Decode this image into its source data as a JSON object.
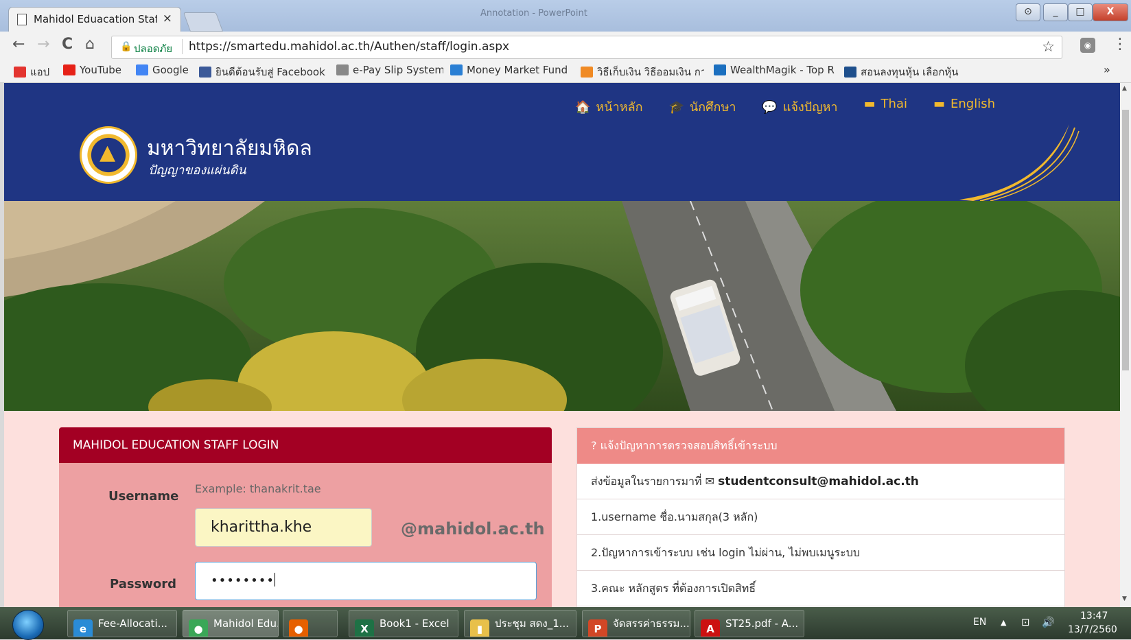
{
  "window": {
    "tab_title": "Mahidol Eduacation Staff",
    "tab_close": "×",
    "caption": "Annotation - PowerPoint",
    "controls": {
      "minimize": "_",
      "maximize": "□",
      "close": "X"
    }
  },
  "toolbar": {
    "back": "←",
    "forward": "→",
    "reload": "C",
    "home": "⌂",
    "secure_label": "ปลอดภัย",
    "url": "https://smartedu.mahidol.ac.th/Authen/staff/login.aspx",
    "star": "☆",
    "menu": "⋮"
  },
  "bookmarks": {
    "items": [
      {
        "label": "แอป",
        "icon": "apps-grid-icon",
        "color": "#e3342f"
      },
      {
        "label": "YouTube",
        "icon": "youtube-icon",
        "color": "#e62117"
      },
      {
        "label": "Google",
        "icon": "google-icon",
        "color": "#4285f4"
      },
      {
        "label": "ยินดีต้อนรับสู่ Facebook",
        "icon": "facebook-icon",
        "color": "#3b5998"
      },
      {
        "label": "e-Pay Slip System",
        "icon": "page-icon",
        "color": "#888888"
      },
      {
        "label": "Money Market Fund",
        "icon": "chart-icon",
        "color": "#2a7fd4"
      },
      {
        "label": "วิธีเก็บเงิน วิธีออมเงิน กา",
        "icon": "k-icon",
        "color": "#f08a24"
      },
      {
        "label": "WealthMagik - Top R",
        "icon": "wm-icon",
        "color": "#1b6fbf"
      },
      {
        "label": "สอนลงทุนหุ้น เลือกหุ้น แ",
        "icon": "a-icon",
        "color": "#1e4f8c"
      }
    ],
    "more": "»"
  },
  "site": {
    "university_name": "มหาวิทยาลัยมหิดล",
    "motto": "ปัญญาของแผ่นดิน",
    "nav": [
      {
        "label": "หน้าหลัก",
        "icon": "🏠"
      },
      {
        "label": "นักศึกษา",
        "icon": "🎓"
      },
      {
        "label": "แจ้งปัญหา",
        "icon": "💬"
      },
      {
        "label": "Thai",
        "icon": "▬"
      },
      {
        "label": "English",
        "icon": "▬"
      }
    ]
  },
  "login": {
    "heading": "MAHIDOL EDUCATION STAFF LOGIN",
    "username_label": "Username",
    "username_hint": "Example: thanakrit.tae",
    "username_value": "kharittha.khe",
    "domain_suffix": "@mahidol.ac.th",
    "password_label": "Password",
    "password_masked": "••••••••"
  },
  "help": {
    "heading": "? แจ้งปัญหาการตรวจสอบสิทธิ์เข้าระบบ",
    "intro": "ส่งข้อมูลในรายการมาที่ ✉",
    "email": "studentconsult@mahidol.ac.th",
    "items": [
      "1.username ชื่อ.นามสกุล(3 หลัก)",
      "2.ปัญหาการเข้าระบบ เช่น login ไม่ผ่าน, ไม่พบเมนูระบบ",
      "3.คณะ หลักสูตร ที่ต้องการเปิดสิทธิ์"
    ]
  },
  "taskbar": {
    "items": [
      {
        "label": "Fee-Allocati...",
        "icon": "ie-icon",
        "glyph": "e",
        "color": "#2a8bd6"
      },
      {
        "label": "Mahidol Edu...",
        "icon": "chrome-icon",
        "glyph": "●",
        "color": "#3aa757",
        "active": true
      },
      {
        "label": "",
        "icon": "firefox-icon",
        "glyph": "●",
        "color": "#e66000"
      },
      {
        "label": "Book1 - Excel",
        "icon": "excel-icon",
        "glyph": "X",
        "color": "#1e7145"
      },
      {
        "label": "ประชุม สดง_1...",
        "icon": "folder-icon",
        "glyph": "▮",
        "color": "#e8c04a"
      },
      {
        "label": "จัดสรรค่าธรรม...",
        "icon": "powerpoint-icon",
        "glyph": "P",
        "color": "#d24726"
      },
      {
        "label": "ST25.pdf - A...",
        "icon": "pdf-icon",
        "glyph": "A",
        "color": "#cc1111"
      }
    ],
    "tray": {
      "lang": "EN",
      "arrow": "▲",
      "network": "⊡",
      "volume": "🔊"
    },
    "time": "13:47",
    "date": "13/7/2560"
  }
}
